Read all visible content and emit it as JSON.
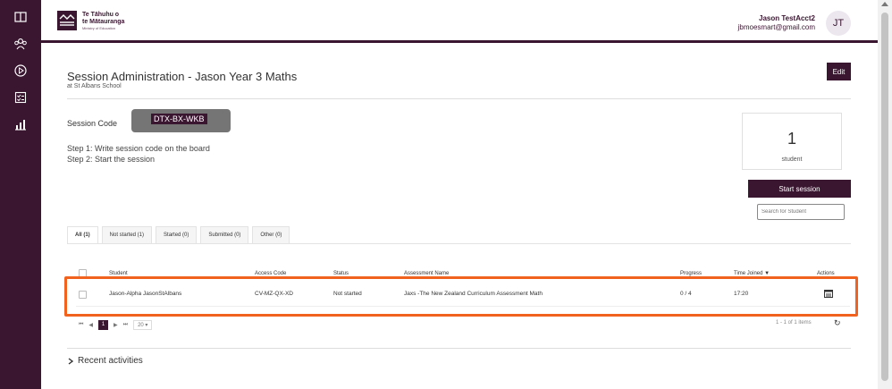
{
  "colors": {
    "brand": "#3a1630",
    "highlight": "#f0621d"
  },
  "sidebar": {
    "items": [
      {
        "icon": "book-icon"
      },
      {
        "icon": "group-icon"
      },
      {
        "icon": "play-circle-icon"
      },
      {
        "icon": "checklist-icon"
      },
      {
        "icon": "bar-chart-icon"
      }
    ]
  },
  "header": {
    "logo_line1": "Te Tāhuhu o",
    "logo_line2": "te Mātauranga",
    "logo_line3": "Ministry of Education",
    "user_name": "Jason TestAcct2",
    "user_email": "jbmoesmart@gmail.com",
    "avatar_initials": "JT"
  },
  "page": {
    "title": "Session Administration - Jason Year 3 Maths",
    "subtitle": "at St Albans School",
    "edit_label": "Edit"
  },
  "session": {
    "code_label": "Session Code",
    "code": "DTX-BX-WKB",
    "step1": "Step 1: Write session code on the board",
    "step2": "Step 2: Start the session",
    "student_count": "1",
    "student_label": "student",
    "start_label": "Start session",
    "search_placeholder": "Search for Student"
  },
  "tabs": [
    {
      "label": "All (1)"
    },
    {
      "label": "Not started (1)"
    },
    {
      "label": "Started (0)"
    },
    {
      "label": "Submitted (0)"
    },
    {
      "label": "Other (0)"
    }
  ],
  "grid": {
    "columns": [
      "Student",
      "Access Code",
      "Status",
      "Assessment Name",
      "Progress",
      "Time Joined ▼",
      "Actions"
    ],
    "rows": [
      {
        "student": "Jason-Alpha JasonStAlbans",
        "access_code": "CV-MZ-QX-XD",
        "status": "Not started",
        "assessment": "Jaxs -The New Zealand Curriculum Assessment Math",
        "progress": "0 / 4",
        "time_joined": "17:20"
      }
    ]
  },
  "pager": {
    "first": "⏮",
    "prev": "◀",
    "page": "1",
    "next": "▶",
    "last": "⏭",
    "page_size": "20  ▾",
    "items_text": "1 - 1 of 1 items"
  },
  "recent_label": "Recent activities"
}
